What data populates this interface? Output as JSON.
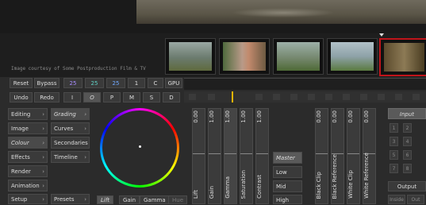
{
  "credit": "Image courtesy of Some Postproduction Film & TV",
  "toolbar_row1": {
    "reset": "Reset",
    "bypass": "Bypass",
    "v1": "25",
    "v2": "25",
    "v3": "25",
    "v4": "1",
    "c": "C",
    "gpu": "GPU"
  },
  "toolbar_row2": {
    "undo": "Undo",
    "redo": "Redo",
    "i": "I",
    "o": "O",
    "p": "P",
    "m": "M",
    "s": "S",
    "d": "D"
  },
  "nav": [
    "Editing",
    "Image",
    "Colour",
    "Effects",
    "Render",
    "Animation",
    "Setup"
  ],
  "nav_active": "Colour",
  "subnav": [
    "Grading",
    "Curves",
    "Secondaries",
    "Timeline",
    "Presets"
  ],
  "sliders_group1": [
    {
      "label": "Lift",
      "value": "0.00"
    },
    {
      "label": "Gain",
      "value": "1.00"
    },
    {
      "label": "Gamma",
      "value": "1.00"
    },
    {
      "label": "Saturation",
      "value": "1.00"
    },
    {
      "label": "Contrast",
      "value": "1.00"
    }
  ],
  "modes": [
    "Master",
    "Low",
    "Mid",
    "High"
  ],
  "sliders_group2": [
    {
      "label": "Black Clip",
      "value": "0.00"
    },
    {
      "label": "Black Reference",
      "value": "0.00"
    },
    {
      "label": "White Clip",
      "value": "0.00"
    },
    {
      "label": "White Reference",
      "value": "0.00"
    }
  ],
  "right_panel": {
    "input": "Input",
    "output": "Output",
    "numbers": [
      "1",
      "2",
      "3",
      "4",
      "5",
      "6",
      "7",
      "8"
    ],
    "small": [
      "Inside",
      "Out"
    ]
  },
  "bottom_tabs": [
    "Lift",
    "Gain",
    "Gamma",
    "Hue"
  ],
  "colors": {
    "selected_border": "#c0141a",
    "playhead": "#e5b400",
    "accent_blue": "#6fa8ff",
    "accent_teal": "#5fd0c4"
  }
}
